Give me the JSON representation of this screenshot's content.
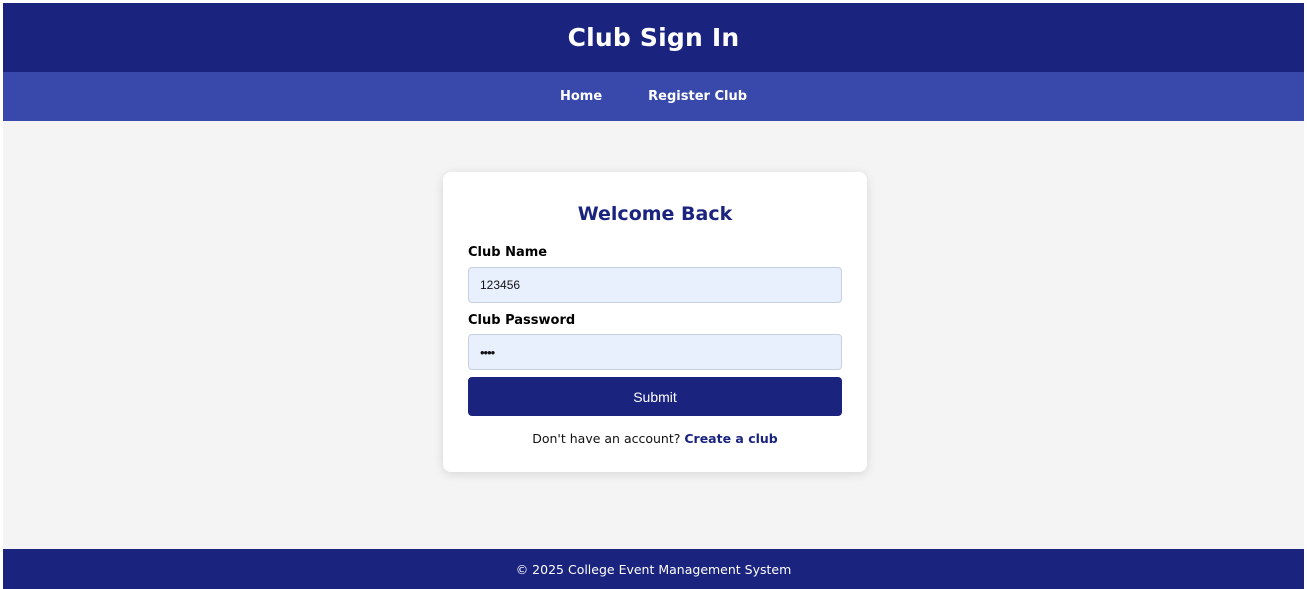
{
  "header": {
    "title": "Club Sign In"
  },
  "nav": {
    "items": [
      {
        "label": "Home"
      },
      {
        "label": "Register Club"
      }
    ]
  },
  "login": {
    "heading": "Welcome Back",
    "club_name_label": "Club Name",
    "club_name_value": "123456",
    "password_label": "Club Password",
    "password_value": "••••",
    "submit_label": "Submit",
    "account_prompt": "Don't have an account?",
    "create_link": "Create a club"
  },
  "footer": {
    "text": "© 2025 College Event Management System"
  },
  "colors": {
    "primary": "#1a237e",
    "nav": "#3949ab",
    "background": "#f4f4f4",
    "input_bg": "#e8f0fe"
  }
}
